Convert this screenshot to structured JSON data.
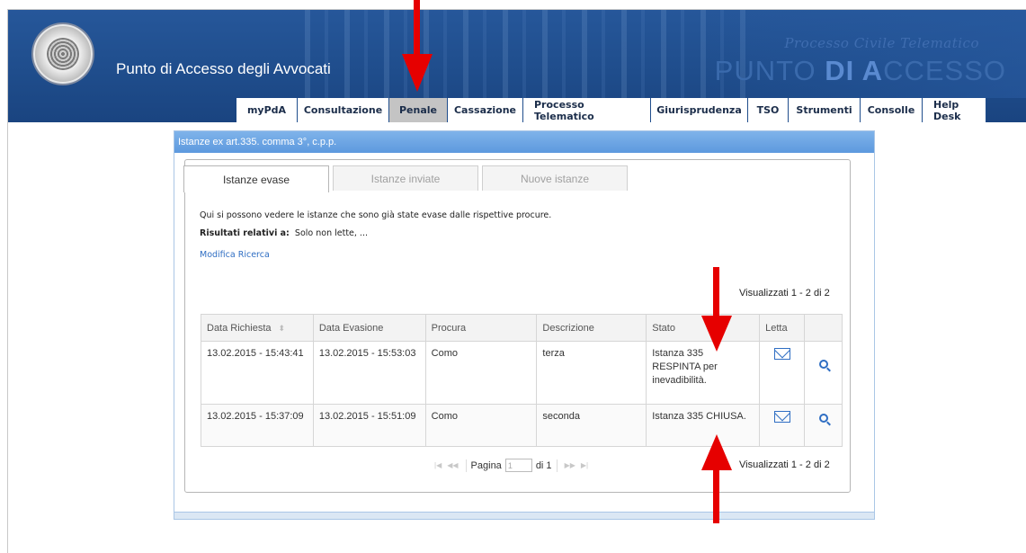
{
  "header": {
    "title": "Punto di Accesso degli Avvocati",
    "brand_small": "Processo Civile Telematico",
    "brand_big_pre": "PUNTO ",
    "brand_big_bold": "DI A",
    "brand_big_post": "CCESSO"
  },
  "nav": {
    "tabs": [
      "myPdA",
      "Consultazione",
      "Penale",
      "Cassazione",
      "Processo Telematico",
      "Giurisprudenza",
      "TSO",
      "Strumenti",
      "Consolle",
      "Help Desk"
    ],
    "active": "Penale"
  },
  "panel": {
    "title": "Istanze ex art.335. comma 3°, c.p.p.",
    "subtabs": [
      "Istanze evase",
      "Istanze inviate",
      "Nuove istanze"
    ],
    "active_subtab": "Istanze evase",
    "description": "Qui si possono vedere le istanze che sono già state evase dalle rispettive procure.",
    "results_label": "Risultati relativi a:",
    "results_value": "Solo non lette, ...",
    "modify_link": "Modifica Ricerca",
    "count": "Visualizzati 1 - 2 di 2"
  },
  "table": {
    "columns": [
      "Data Richiesta",
      "Data Evasione",
      "Procura",
      "Descrizione",
      "Stato",
      "Letta"
    ],
    "rows": [
      {
        "data_richiesta": "13.02.2015 - 15:43:41",
        "data_evasione": "13.02.2015 - 15:53:03",
        "procura": "Como",
        "descrizione": "terza",
        "stato": "Istanza 335 RESPINTA per inevadibilità."
      },
      {
        "data_richiesta": "13.02.2015 - 15:37:09",
        "data_evasione": "13.02.2015 - 15:51:09",
        "procura": "Como",
        "descrizione": "seconda",
        "stato": "Istanza 335 CHIUSA."
      }
    ]
  },
  "pager": {
    "label": "Pagina",
    "value": "1",
    "of": "di 1"
  },
  "icons": {
    "letta": "mail-icon",
    "view": "search-icon"
  },
  "colors": {
    "header_blue": "#1f4d8c",
    "panel_head": "#6aa5e4",
    "arrow_red": "#e60000",
    "link_blue": "#2f6ec3"
  }
}
